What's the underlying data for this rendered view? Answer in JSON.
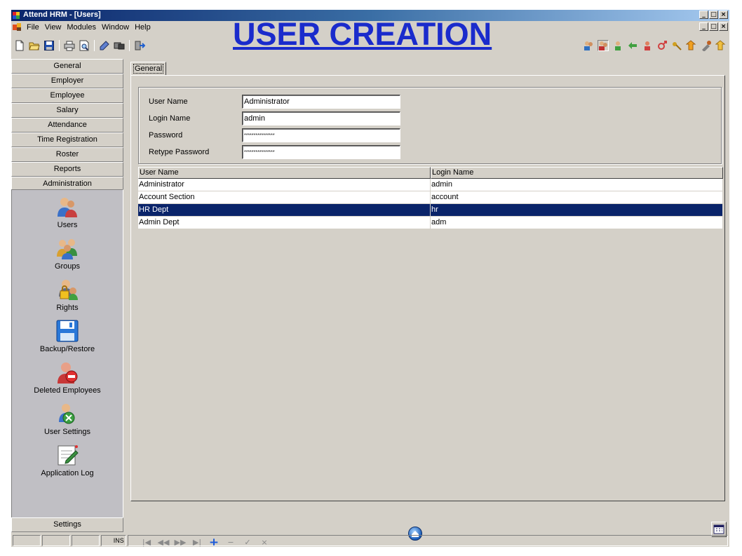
{
  "window": {
    "title": "Attend HRM - [Users]",
    "caption_buttons": [
      "_",
      "□",
      "×"
    ]
  },
  "menu": {
    "items": [
      "File",
      "View",
      "Modules",
      "Window",
      "Help"
    ]
  },
  "banner": "USER CREATION",
  "left_nav": {
    "buttons": [
      "General",
      "Employer",
      "Employee",
      "Salary",
      "Attendance",
      "Time Registration",
      "Roster",
      "Reports",
      "Administration"
    ],
    "items": [
      {
        "label": "Users",
        "icon": "users-icon"
      },
      {
        "label": "Groups",
        "icon": "groups-icon"
      },
      {
        "label": "Rights",
        "icon": "rights-icon"
      },
      {
        "label": "Backup/Restore",
        "icon": "floppy-disk-icon"
      },
      {
        "label": "Deleted Employees",
        "icon": "deleted-employee-icon"
      },
      {
        "label": "User Settings",
        "icon": "user-settings-icon"
      },
      {
        "label": "Application Log",
        "icon": "application-log-icon"
      }
    ],
    "settings_label": "Settings"
  },
  "tab": {
    "label": "General"
  },
  "form": {
    "user_name_label": "User Name",
    "user_name_value": "Administrator",
    "login_name_label": "Login Name",
    "login_name_value": "admin",
    "password_label": "Password",
    "password_value": "****************",
    "retype_password_label": "Retype Password",
    "retype_password_value": "****************"
  },
  "grid": {
    "columns": [
      "User Name",
      "Login Name"
    ],
    "rows": [
      {
        "user_name": "Administrator",
        "login_name": "admin",
        "selected": false
      },
      {
        "user_name": "Account Section",
        "login_name": "account",
        "selected": false
      },
      {
        "user_name": "HR Dept",
        "login_name": "hr",
        "selected": true
      },
      {
        "user_name": "Admin Dept",
        "login_name": "adm",
        "selected": false
      }
    ]
  },
  "navigator": {
    "buttons": [
      "|◀",
      "◀◀",
      "▶▶",
      "▶|",
      "+",
      "−",
      "✓",
      "×"
    ]
  },
  "statusbar": {
    "mode": "INS"
  },
  "colors": {
    "banner": "#1a2bcc",
    "selection": "#0a246a",
    "titlebar_start": "#0a246a"
  }
}
